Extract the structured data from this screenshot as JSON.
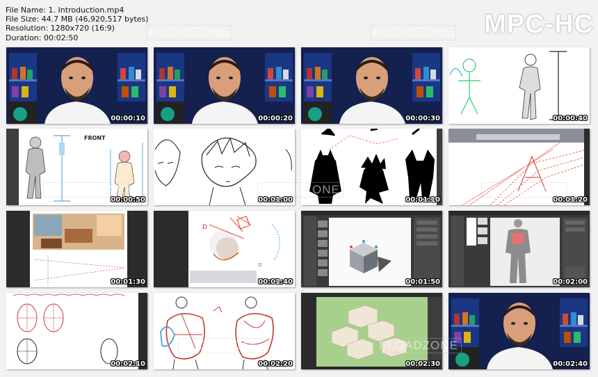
{
  "info": {
    "file_name": "File Name: 1. Introduction.mp4",
    "file_size": "File Size: 44.7 MB (46,920,517 bytes)",
    "resolution": "Resolution: 1280x720 (16:9)",
    "duration": "Duration: 00:02:50"
  },
  "brand": "MPC-HC",
  "watermark": "I-LOADZONE",
  "thumbnails": [
    {
      "time": "00:00:10",
      "scene": "presenter"
    },
    {
      "time": "00:00:20",
      "scene": "presenter"
    },
    {
      "time": "00:00:30",
      "scene": "presenter"
    },
    {
      "time": "00:00:40",
      "scene": "figure-sketch"
    },
    {
      "time": "00:00:50",
      "scene": "figure-front"
    },
    {
      "time": "00:01:00",
      "scene": "face-sketch"
    },
    {
      "time": "00:01:10",
      "scene": "silhouettes"
    },
    {
      "time": "00:01:20",
      "scene": "perspective"
    },
    {
      "time": "00:01:30",
      "scene": "room"
    },
    {
      "time": "00:01:40",
      "scene": "sphere"
    },
    {
      "time": "00:01:50",
      "scene": "software-cube"
    },
    {
      "time": "00:02:00",
      "scene": "software-figure"
    },
    {
      "time": "00:02:10",
      "scene": "heads"
    },
    {
      "time": "00:02:20",
      "scene": "muscles"
    },
    {
      "time": "00:02:30",
      "scene": "blocks"
    },
    {
      "time": "00:02:40",
      "scene": "presenter"
    }
  ],
  "labels": {
    "front": "FRONT"
  }
}
